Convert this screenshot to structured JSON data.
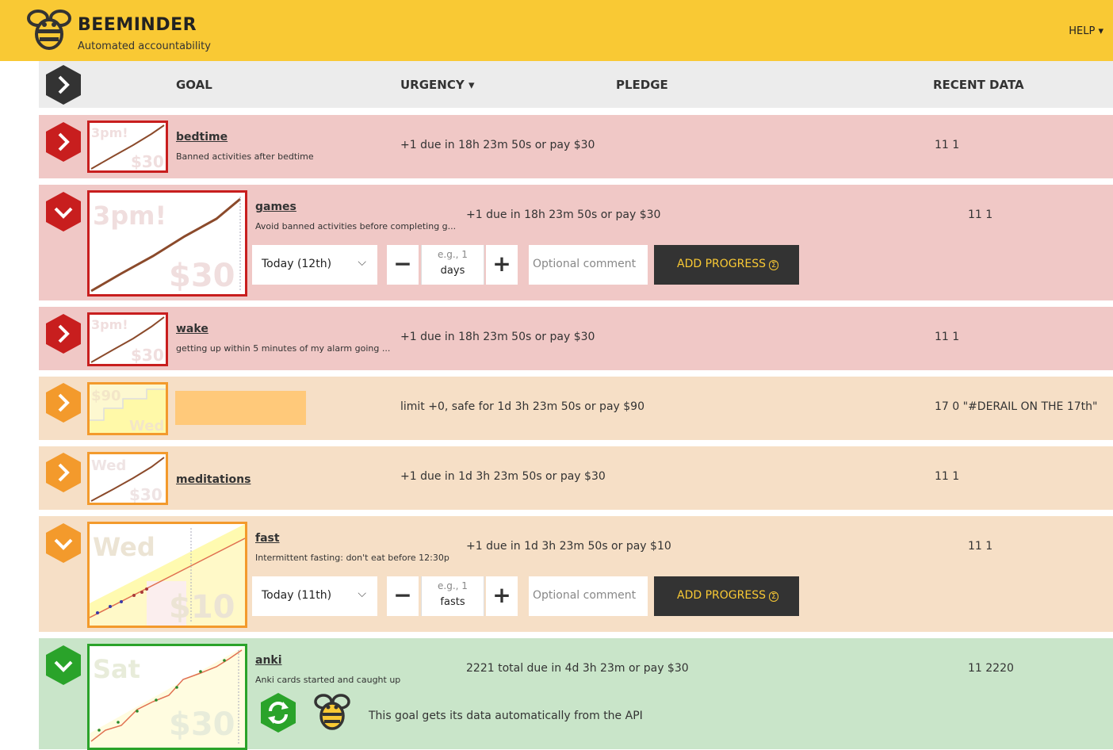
{
  "brand": {
    "name": "BEEMINDER",
    "tagline": "Automated accountability"
  },
  "nav": {
    "help": "HELP"
  },
  "header": {
    "goal": "GOAL",
    "urgency": "URGENCY",
    "pledge": "PLEDGE",
    "recent": "RECENT DATA"
  },
  "goals": [
    {
      "name": "bedtime",
      "desc": "Banned activities after bedtime",
      "urgency": "+1 due in 18h 23m 50s or pay $30",
      "recent": "11 1",
      "thumb_top": "3pm!",
      "thumb_bottom": "$30"
    },
    {
      "name": "games",
      "desc": "Avoid banned activities before completing g...",
      "urgency": "+1 due in 18h 23m 50s or pay $30",
      "recent": "11 1",
      "thumb_top": "3pm!",
      "thumb_bottom": "$30",
      "day": "Today (12th)",
      "placeholder": "e.g., 1",
      "unit": "days",
      "comment_placeholder": "Optional comment",
      "add_label": "ADD PROGRESS"
    },
    {
      "name": "wake",
      "desc": "getting up within 5 minutes of my alarm going ...",
      "urgency": "+1 due in 18h 23m 50s or pay $30",
      "recent": "11 1",
      "thumb_top": "3pm!",
      "thumb_bottom": "$30"
    },
    {
      "name": "",
      "desc": "",
      "urgency": "limit +0, safe for 1d 3h 23m 50s or pay $90",
      "recent": "17 0 \"#DERAIL ON THE 17th\"",
      "thumb_top": "$90",
      "thumb_bottom": "Wed"
    },
    {
      "name": "meditations",
      "desc": "",
      "urgency": "+1 due in 1d 3h 23m 50s or pay $30",
      "recent": "11 1",
      "thumb_top": "Wed",
      "thumb_bottom": "$30"
    },
    {
      "name": "fast",
      "desc": "Intermittent fasting: don't eat before 12:30p",
      "urgency": "+1 due in 1d 3h 23m 50s or pay $10",
      "recent": "11 1",
      "thumb_top": "Wed",
      "thumb_bottom": "$10",
      "day": "Today (11th)",
      "placeholder": "e.g., 1",
      "unit": "fasts",
      "comment_placeholder": "Optional comment",
      "add_label": "ADD PROGRESS"
    },
    {
      "name": "anki",
      "desc": "Anki cards started and caught up",
      "urgency": "2221 total due in 4d 3h 23m or pay $30",
      "recent": "11 2220",
      "thumb_top": "Sat",
      "thumb_bottom": "$30",
      "auto_text": "This goal gets its data automatically from the API"
    }
  ],
  "colors": {
    "yellow": "#f9c934",
    "red": "#c81e1e",
    "orange": "#f39a2c",
    "green": "#2aa32a",
    "dark": "#333333"
  }
}
